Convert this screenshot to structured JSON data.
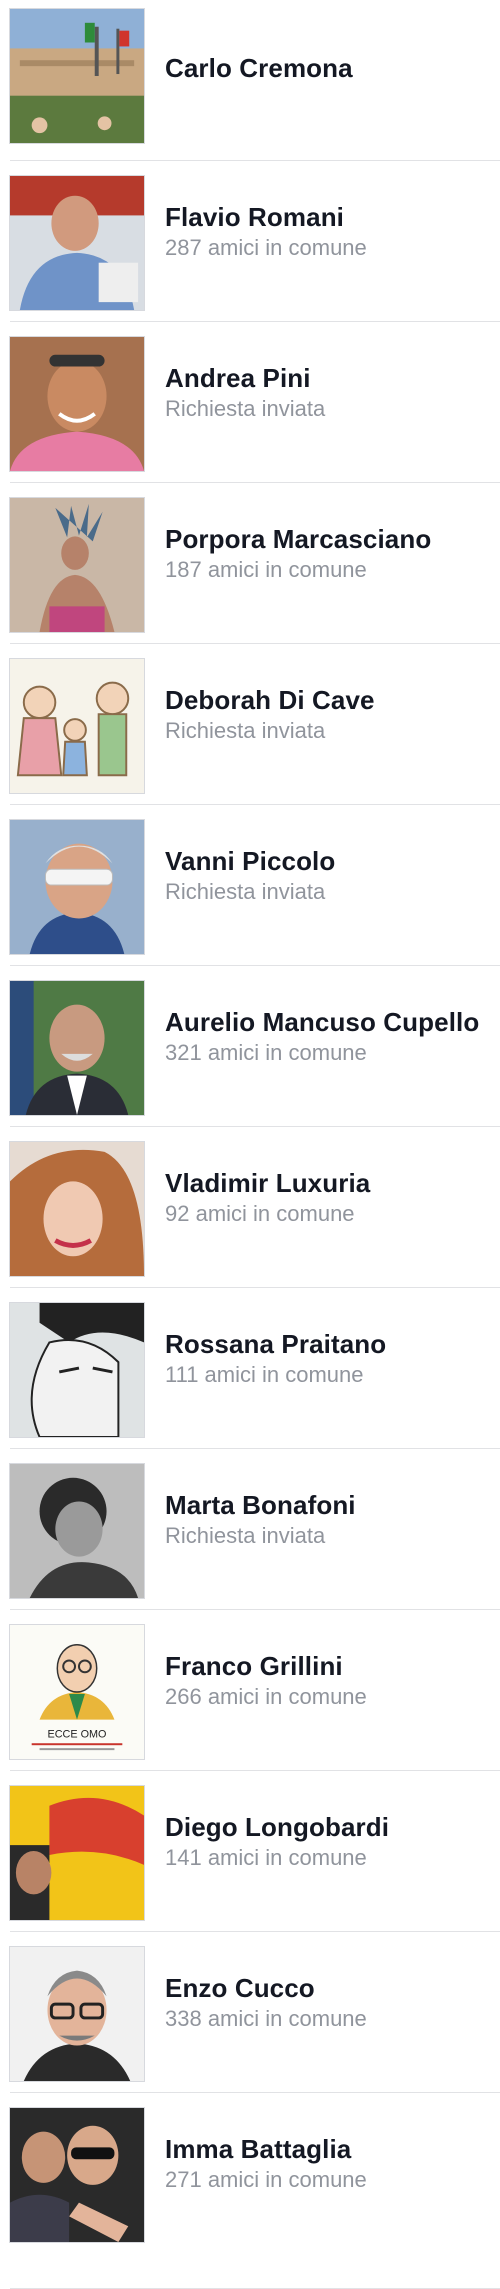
{
  "people": [
    {
      "name": "Carlo Cremona",
      "subtitle": "",
      "avatar": "photo-building-flags",
      "bg": "#8fa7c0"
    },
    {
      "name": "Flavio Romani",
      "subtitle": "287 amici in comune",
      "avatar": "photo-man-bald-blue-shirt",
      "bg": "#6a89b5"
    },
    {
      "name": "Andrea Pini",
      "subtitle": "Richiesta inviata",
      "avatar": "photo-man-sunglasses-pink-shirt",
      "bg": "#b47a5a"
    },
    {
      "name": "Porpora Marcasciano",
      "subtitle": "187 amici in comune",
      "avatar": "photo-person-feather-headdress",
      "bg": "#a88a78"
    },
    {
      "name": "Deborah Di Cave",
      "subtitle": "Richiesta inviata",
      "avatar": "illustration-cartoon-family",
      "bg": "#f3f1e8"
    },
    {
      "name": "Vanni Piccolo",
      "subtitle": "Richiesta inviata",
      "avatar": "photo-man-white-sunglasses",
      "bg": "#7c93b0"
    },
    {
      "name": "Aurelio Mancuso Cupello",
      "subtitle": "321 amici in comune",
      "avatar": "photo-man-bald-suit",
      "bg": "#4c6f47"
    },
    {
      "name": "Vladimir Luxuria",
      "subtitle": "92 amici in comune",
      "avatar": "photo-woman-auburn-hair",
      "bg": "#6b4a3a"
    },
    {
      "name": "Rossana Praitano",
      "subtitle": "111 amici in comune",
      "avatar": "illustration-comic-face",
      "bg": "#dfe3e4"
    },
    {
      "name": "Marta Bonafoni",
      "subtitle": "Richiesta inviata",
      "avatar": "photo-woman-bw-curly-hair",
      "bg": "#8d8d8d"
    },
    {
      "name": "Franco Grillini",
      "subtitle": "266 amici in comune",
      "avatar": "illustration-ecce-omo-book",
      "bg": "#fbfbf6"
    },
    {
      "name": "Diego Longobardi",
      "subtitle": "141 amici in comune",
      "avatar": "photo-man-yellow-festa-banner",
      "bg": "#e8b820"
    },
    {
      "name": "Enzo Cucco",
      "subtitle": "338 amici in comune",
      "avatar": "photo-man-glasses-grey-hair",
      "bg": "#e6e6e6"
    },
    {
      "name": "Imma Battaglia",
      "subtitle": "271 amici in comune",
      "avatar": "photo-two-people-pointing",
      "bg": "#2a2a2a"
    }
  ],
  "book_cover_text": "ECCE OMO"
}
